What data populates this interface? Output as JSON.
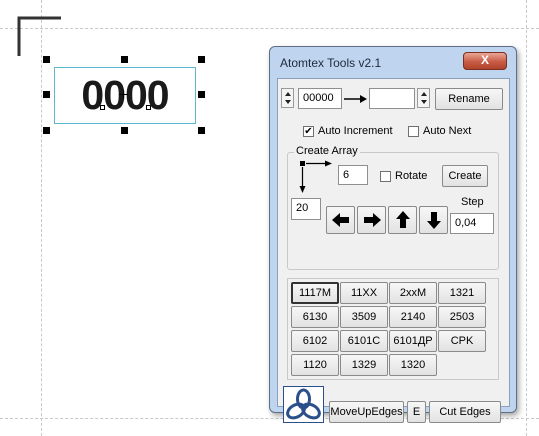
{
  "canvas": {
    "label_text": "0000"
  },
  "window": {
    "title": "Atomtex Tools v2.1",
    "close_label": "X"
  },
  "numbering": {
    "start_value": "00000",
    "second_value": "",
    "rename_label": "Rename",
    "auto_increment": {
      "label": "Auto Increment",
      "checked": true
    },
    "auto_next": {
      "label": "Auto Next",
      "checked": false
    }
  },
  "create_array": {
    "group_label": "Create Array",
    "columns_value": "6",
    "rows_value": "20",
    "rotate": {
      "label": "Rotate",
      "checked": false
    },
    "create_label": "Create",
    "step_label": "Step",
    "step_value": "0,04"
  },
  "presets": [
    "1117M",
    "11XX",
    "2xxM",
    "1321",
    "6130",
    "3509",
    "2140",
    "2503",
    "6102",
    "6101C",
    "6101ДР",
    "CPK",
    "1120",
    "1329",
    "1320"
  ],
  "bottom_bar": {
    "move_up_edges_label": "MoveUpEdges",
    "e_label": "E",
    "cut_edges_label": "Cut Edges"
  },
  "icons": {
    "logo": "atomtex-logo-icon",
    "arrows": [
      "arrow-left-icon",
      "arrow-right-icon",
      "arrow-up-icon",
      "arrow-down-icon"
    ]
  },
  "colors": {
    "window_frame": "#bfd4ee",
    "close_button": "#c75b44",
    "selection_frame": "#5eb8cf",
    "logo_blue": "#2a4f8a"
  }
}
